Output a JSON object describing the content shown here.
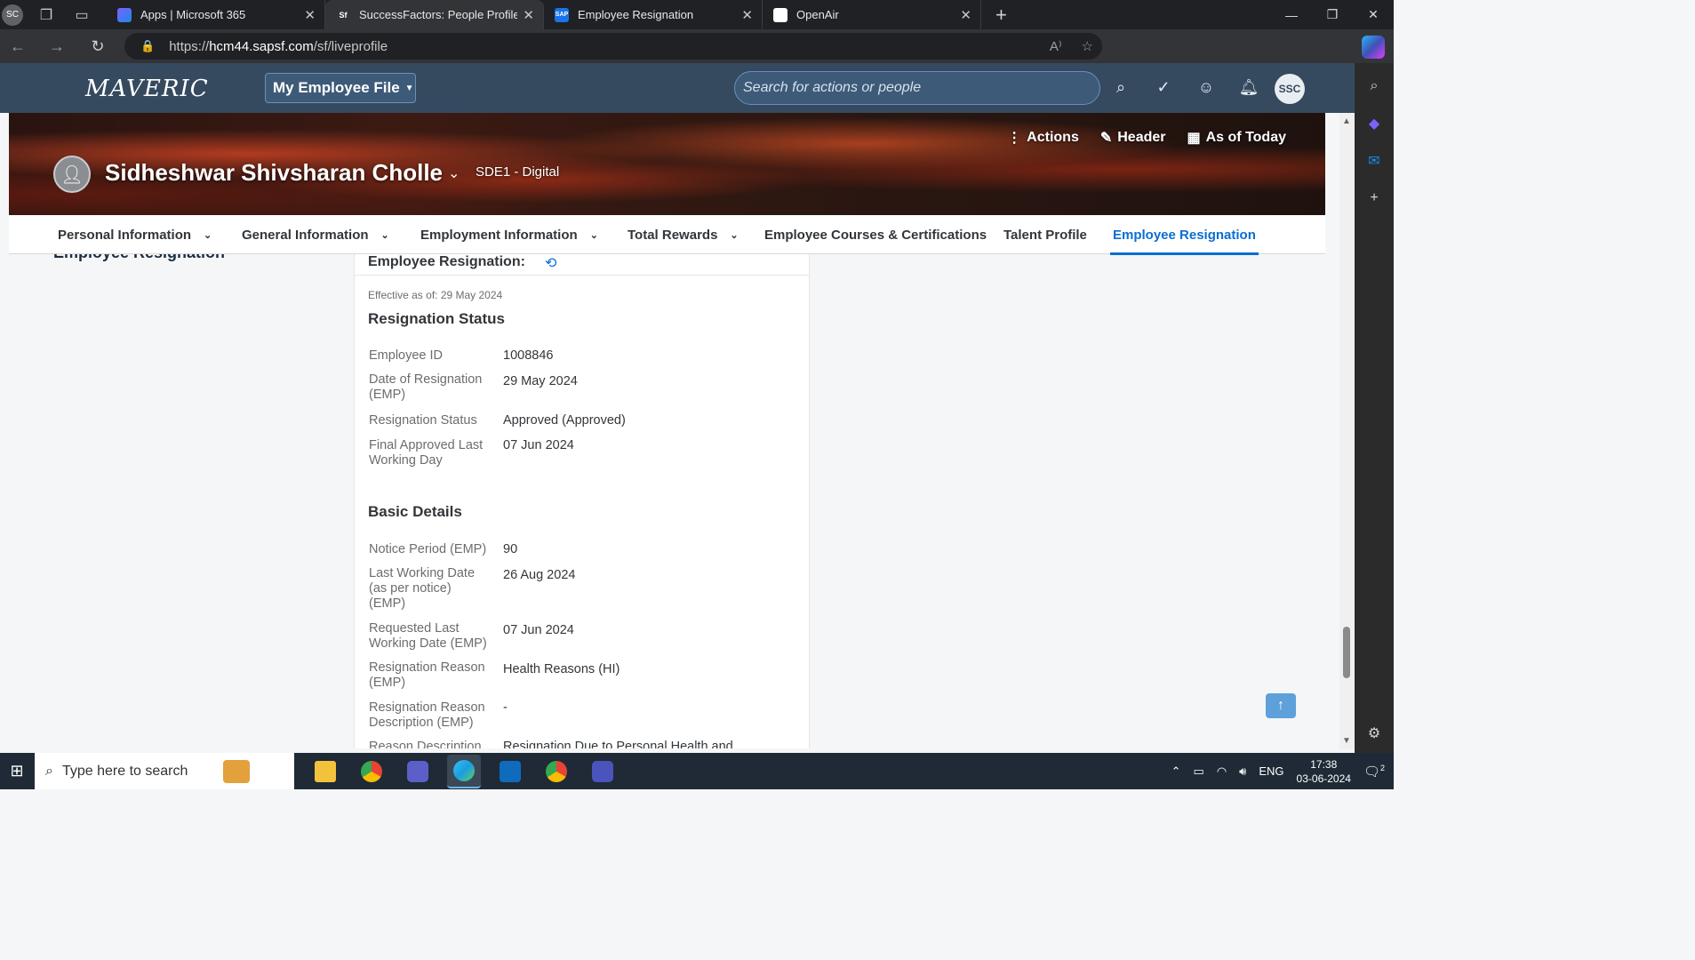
{
  "browser": {
    "profile_initials": "SC",
    "tabs": [
      {
        "label": "Apps | Microsoft 365",
        "active": false
      },
      {
        "label": "SuccessFactors: People Profile for",
        "active": true
      },
      {
        "label": "Employee Resignation",
        "active": false
      },
      {
        "label": "OpenAir",
        "active": false
      }
    ],
    "url_prefix": "https://",
    "url_host": "hcm44.sapsf.com",
    "url_path": "/sf/liveprofile"
  },
  "sf_header": {
    "logo": "MAVERIC",
    "file_menu": "My Employee File",
    "search_placeholder": "Search for actions or people",
    "avatar_initials": "SSC"
  },
  "profile": {
    "name": "Sidheshwar Shivsharan Cholle",
    "job_title": "SDE1 - Digital",
    "actions": [
      "Actions",
      "Header",
      "As of Today"
    ]
  },
  "section_tabs": [
    {
      "label": "Personal Information",
      "dropdown": true
    },
    {
      "label": "General Information",
      "dropdown": true
    },
    {
      "label": "Employment Information",
      "dropdown": true
    },
    {
      "label": "Total Rewards",
      "dropdown": true
    },
    {
      "label": "Employee Courses & Certifications",
      "dropdown": false
    },
    {
      "label": "Talent Profile",
      "dropdown": false
    },
    {
      "label": "Employee Resignation",
      "dropdown": false,
      "active": true
    }
  ],
  "content": {
    "side_heading": "Employee Resignation",
    "card_title": "Employee Resignation:",
    "effective": "Effective as of: 29 May 2024",
    "group1_title": "Resignation Status",
    "group1_rows": [
      {
        "label": "Employee ID",
        "value": "1008846"
      },
      {
        "label": "Date of Resignation (EMP)",
        "value": "29 May 2024"
      },
      {
        "label": "Resignation Status",
        "value": "Approved (Approved)"
      },
      {
        "label": "Final Approved Last Working Day",
        "value": "07 Jun 2024"
      }
    ],
    "group2_title": "Basic Details",
    "group2_rows": [
      {
        "label": "Notice Period (EMP)",
        "value": "90"
      },
      {
        "label": "Last Working Date (as per notice) (EMP)",
        "value": "26 Aug 2024"
      },
      {
        "label": "Requested Last Working Date (EMP)",
        "value": "07 Jun 2024"
      },
      {
        "label": "Resignation Reason (EMP)",
        "value": "Health Reasons (HI)"
      },
      {
        "label": "Resignation Reason Description (EMP)",
        "value": "-"
      },
      {
        "label": "Reason Description",
        "value": "Resignation Due to Personal Health and"
      }
    ]
  },
  "taskbar": {
    "search_placeholder": "Type here to search",
    "language": "ENG",
    "time": "17:38",
    "date": "03-06-2024",
    "notification_count": "2"
  }
}
